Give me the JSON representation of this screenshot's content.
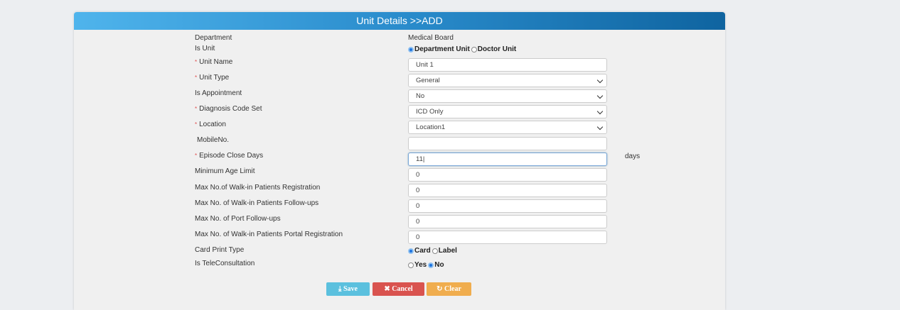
{
  "header": {
    "title": "Unit Details >>ADD"
  },
  "form": {
    "department_label": "Department",
    "department_value": "Medical Board",
    "is_unit_label": "Is Unit",
    "is_unit_options": [
      "Department Unit",
      "Doctor Unit"
    ],
    "unit_name_label": "Unit Name",
    "unit_name_value": "Unit 1",
    "unit_type_label": "Unit Type",
    "unit_type_value": "General",
    "is_appointment_label": "Is Appointment",
    "is_appointment_value": "No",
    "diagnosis_label": "Diagnosis Code Set",
    "diagnosis_value": "ICD Only",
    "location_label": "Location",
    "location_value": "Location1",
    "mobile_label": "MobileNo.",
    "mobile_value": "",
    "episode_label": "Episode Close Days",
    "episode_value": "11|",
    "episode_unit": "days",
    "min_age_label": "Minimum Age Limit",
    "min_age_value": "0",
    "walkin_reg_label": "Max No.of Walk-in Patients Registration",
    "walkin_reg_value": "0",
    "walkin_fu_label": "Max No. of Walk-in Patients Follow-ups",
    "walkin_fu_value": "0",
    "port_fu_label": "Max No. of Port Follow-ups",
    "port_fu_value": "0",
    "portal_reg_label": "Max No. of Walk-in Patients Portal Registration",
    "portal_reg_value": "0",
    "card_label": "Card Print Type",
    "card_options": [
      "Card",
      "Label"
    ],
    "tele_label": "Is TeleConsultation",
    "tele_options": [
      "Yes",
      "No"
    ],
    "required_mark": "*"
  },
  "buttons": {
    "save": "Save",
    "cancel": "Cancel",
    "clear": "Clear"
  },
  "colors": {
    "save": "#5bc0de",
    "cancel": "#d9534f",
    "clear": "#f0ad4e"
  }
}
